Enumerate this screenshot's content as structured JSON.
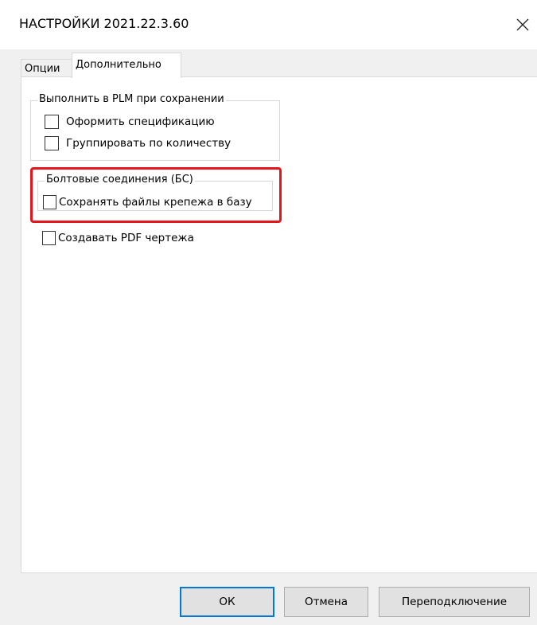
{
  "window": {
    "title": "НАСТРОЙКИ 2021.22.3.60",
    "close_icon": "close-icon"
  },
  "tabs": [
    {
      "label": "Опции",
      "active": false
    },
    {
      "label": "Дополнительно",
      "active": true
    }
  ],
  "groups": {
    "plm": {
      "title": "Выполнить в PLM при сохранении",
      "items": [
        {
          "label": "Оформить спецификацию",
          "checked": false
        },
        {
          "label": "Группировать по количеству",
          "checked": false
        }
      ]
    },
    "bolts": {
      "title": "Болтовые соединения (БС)",
      "items": [
        {
          "label": "Сохранять файлы крепежа в базу",
          "checked": false
        }
      ]
    }
  },
  "standalone": {
    "create_pdf": {
      "label": "Создавать PDF чертежа",
      "checked": false
    }
  },
  "buttons": {
    "ok": "ОК",
    "cancel": "Отмена",
    "reconnect": "Переподключение"
  },
  "colors": {
    "highlight": "#e8141c",
    "default_button_border": "#0078d7"
  }
}
